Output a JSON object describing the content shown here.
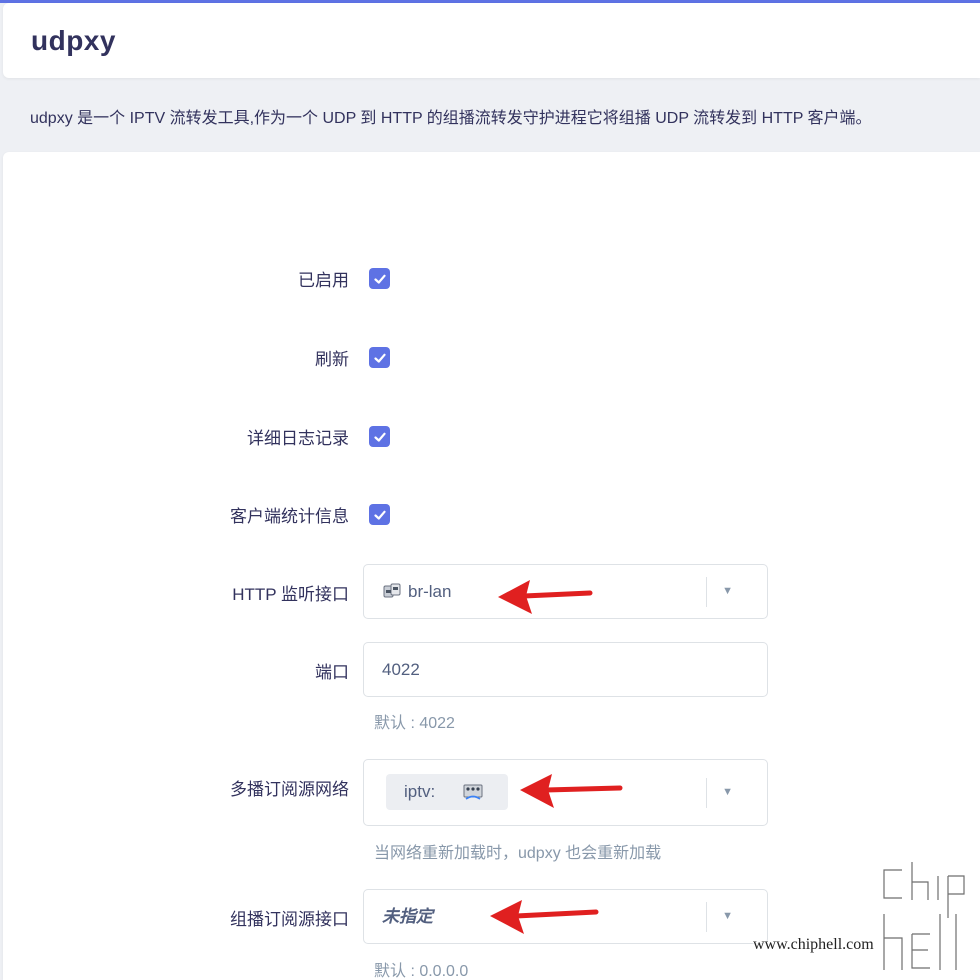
{
  "header": {
    "title": "udpxy"
  },
  "description": "udpxy 是一个 IPTV 流转发工具,作为一个 UDP 到 HTTP 的组播流转发守护进程它将组播 UDP 流转发到 HTTP 客户端。",
  "colors": {
    "accent": "#5e72e4",
    "arrow": "#e02020"
  },
  "form": {
    "enabled": {
      "label": "已启用",
      "checked": true
    },
    "refresh": {
      "label": "刷新",
      "checked": true
    },
    "verbose": {
      "label": "详细日志记录",
      "checked": true
    },
    "client_stats": {
      "label": "客户端统计信息",
      "checked": true
    },
    "http_iface": {
      "label": "HTTP 监听接口",
      "value": "br-lan",
      "icon": "network-interface-icon"
    },
    "port": {
      "label": "端口",
      "placeholder": "4022",
      "hint": "默认 : 4022"
    },
    "source_network": {
      "label": "多播订阅源网络",
      "value": "iptv:",
      "icon": "network-interface-icon",
      "hint": "当网络重新加载时，udpxy 也会重新加载"
    },
    "source_iface": {
      "label": "组播订阅源接口",
      "value": "未指定",
      "hint": "默认 : 0.0.0.0"
    }
  },
  "watermark": {
    "text": "chiphell",
    "url": "www.chiphell.com"
  }
}
